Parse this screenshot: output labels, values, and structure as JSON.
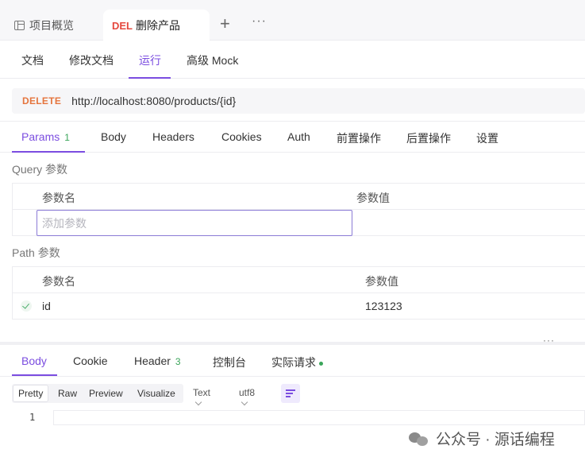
{
  "tabs": {
    "overview_label": "项目概览",
    "active_method": "DEL",
    "active_title": "删除产品",
    "plus": "+",
    "more": "···"
  },
  "subnav": {
    "items": [
      "文档",
      "修改文档",
      "运行",
      "高级 Mock"
    ],
    "active": "运行"
  },
  "request": {
    "method": "DELETE",
    "url": "http://localhost:8080/products/{id}"
  },
  "request_tabs": {
    "params_label": "Params",
    "params_count": "1",
    "items": [
      "Body",
      "Headers",
      "Cookies",
      "Auth",
      "前置操作",
      "后置操作",
      "设置"
    ]
  },
  "query": {
    "section_label": "Query 参数",
    "col_name": "参数名",
    "col_value": "参数值",
    "add_placeholder": "添加参数"
  },
  "path": {
    "section_label": "Path 参数",
    "col_name": "参数名",
    "col_value": "参数值",
    "rows": [
      {
        "name": "id",
        "value": "123123",
        "enabled": true
      }
    ]
  },
  "splitter_dots": "···",
  "response_tabs": {
    "body": "Body",
    "cookie": "Cookie",
    "header": "Header",
    "header_count": "3",
    "console": "控制台",
    "actual": "实际请求"
  },
  "toolbar": {
    "formats": [
      "Pretty",
      "Raw",
      "Preview",
      "Visualize"
    ],
    "selected_format": "Pretty",
    "content_type": "Text",
    "encoding": "utf8"
  },
  "editor": {
    "line_number": "1",
    "content": ""
  },
  "watermark": "公众号 · 源话编程",
  "colors": {
    "accent": "#7b4de0",
    "delete_method": "#e5753e",
    "del_badge": "#e5483e",
    "count_green": "#3aa55a"
  }
}
